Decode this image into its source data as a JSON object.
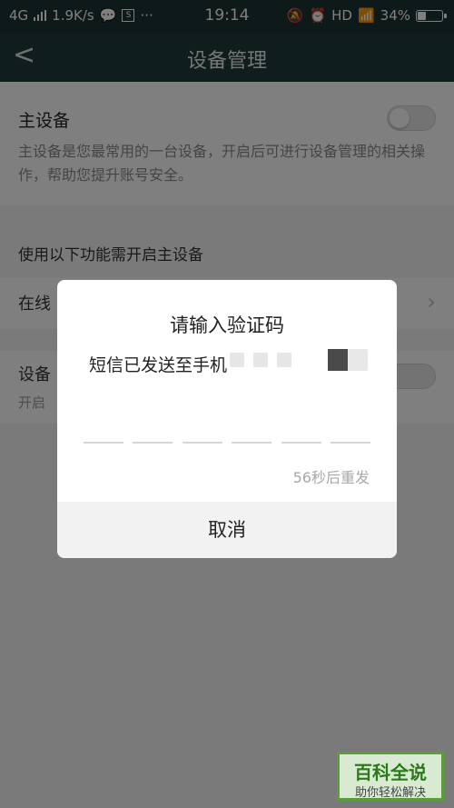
{
  "status_bar": {
    "network": "4G",
    "speed": "1.9K/s",
    "time": "19:14",
    "hd": "HD",
    "battery": "34%",
    "battery_level": 0.34,
    "more": "···"
  },
  "titlebar": {
    "back": "<",
    "title": "设备管理"
  },
  "main_device": {
    "title": "主设备",
    "desc": "主设备是您最常用的一台设备，开启后可进行设备管理的相关操作，帮助您提升账号安全。",
    "enabled": false
  },
  "section_head": "使用以下功能需开启主设备",
  "row_online": {
    "label": "在线"
  },
  "row_device": {
    "label": "设备",
    "sub": "开启"
  },
  "dialog": {
    "title": "请输入验证码",
    "message": "短信已发送至手机",
    "resend": "56秒后重发",
    "cancel": "取消",
    "code_slots": 6
  },
  "watermark": {
    "title": "百科全说",
    "subtitle": "助你轻松解决"
  }
}
